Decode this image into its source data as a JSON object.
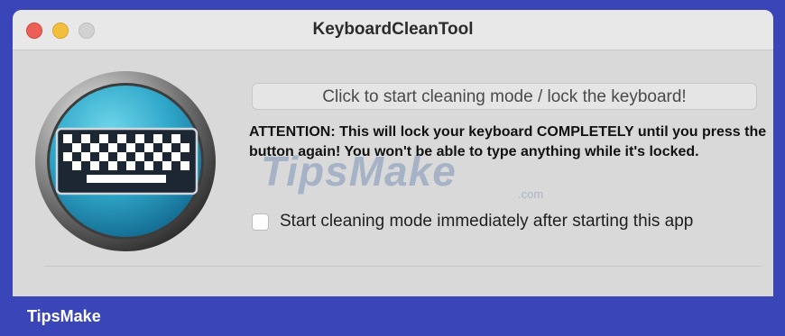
{
  "window": {
    "title": "KeyboardCleanTool"
  },
  "main": {
    "action_button_label": "Click to start cleaning mode / lock the keyboard!",
    "attention_text": "ATTENTION: This will lock your keyboard COMPLETELY until you press the button again! You won't be able to type anything while it's locked.",
    "checkbox_label": "Start cleaning mode immediately after starting this app",
    "checkbox_checked": false
  },
  "icons": {
    "app_icon": "keyboard-icon"
  },
  "watermark": {
    "text": "TipsMake",
    "suffix": ".com"
  },
  "footer": {
    "brand": "TipsMake"
  },
  "colors": {
    "frame_blue": "#3a45b8",
    "window_bg": "#d9d9d9",
    "close": "#ec5f56",
    "minimize": "#f4be3d"
  }
}
